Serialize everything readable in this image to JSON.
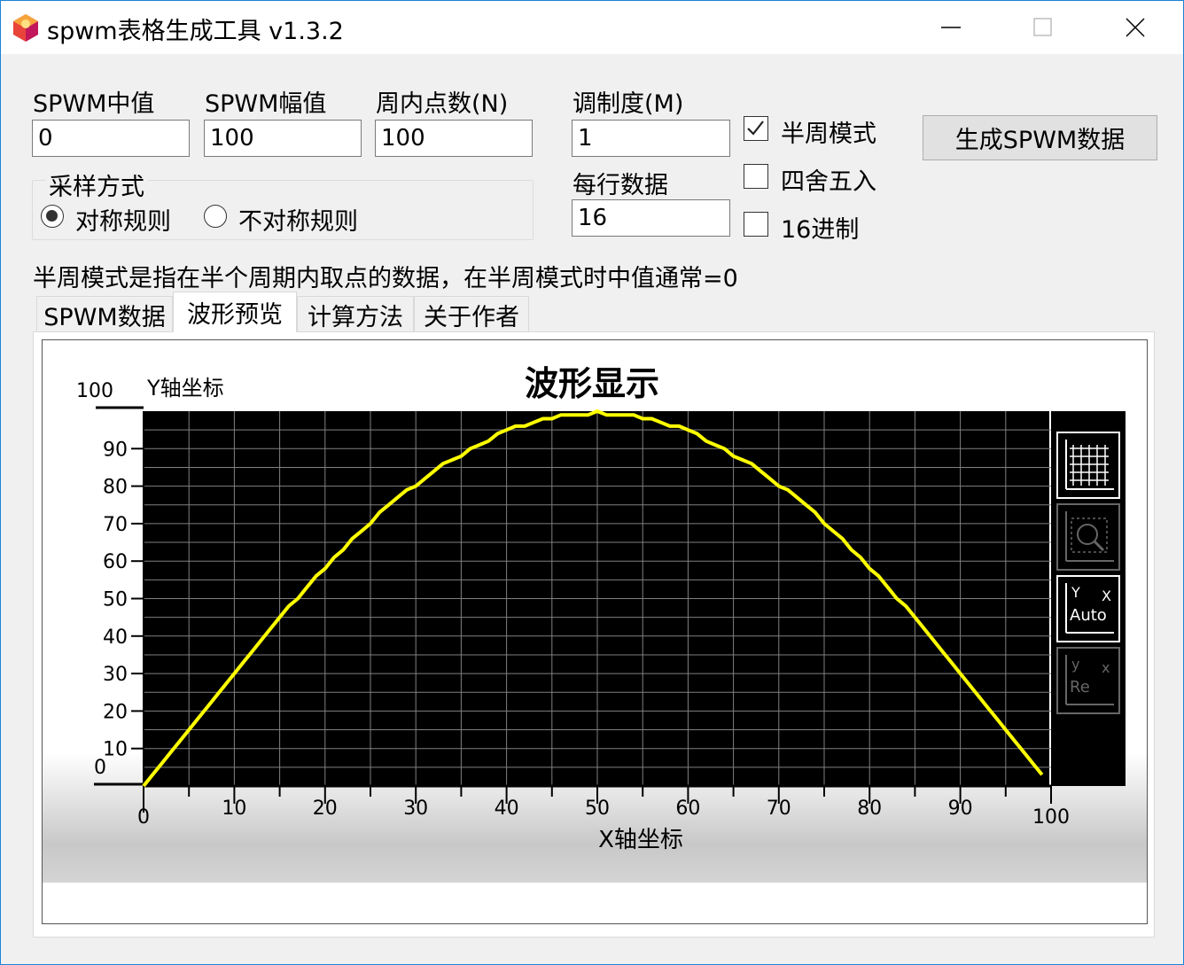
{
  "window": {
    "title": "spwm表格生成工具 v1.3.2"
  },
  "fields": {
    "center": {
      "label": "SPWM中值",
      "value": "0"
    },
    "amplitude": {
      "label": "SPWM幅值",
      "value": "100"
    },
    "points": {
      "label": "周内点数(N)",
      "value": "100"
    },
    "modulation": {
      "label": "调制度(M)",
      "value": "1"
    },
    "per_row": {
      "label": "每行数据",
      "value": "16"
    }
  },
  "sampling": {
    "title": "采样方式",
    "options": [
      {
        "label": "对称规则",
        "selected": true
      },
      {
        "label": "不对称规则",
        "selected": false
      }
    ]
  },
  "checkboxes": [
    {
      "label": "半周模式",
      "checked": true
    },
    {
      "label": "四舍五入",
      "checked": false
    },
    {
      "label": "16进制",
      "checked": false
    }
  ],
  "generate_button": "生成SPWM数据",
  "hint": "半周模式是指在半个周期内取点的数据，在半周模式时中值通常=0",
  "tabs": [
    {
      "label": "SPWM数据",
      "active": false
    },
    {
      "label": "波形预览",
      "active": true
    },
    {
      "label": "计算方法",
      "active": false
    },
    {
      "label": "关于作者",
      "active": false
    }
  ],
  "colors": {
    "line": "#ffff00",
    "plot_bg": "#000000",
    "grid": "#808080"
  },
  "chart_data": {
    "type": "line",
    "title": "波形显示",
    "xlabel": "X轴坐标",
    "ylabel": "Y轴坐标",
    "xlim": [
      0,
      100
    ],
    "ylim": [
      0,
      100
    ],
    "x_ticks": [
      "0",
      "10",
      "20",
      "30",
      "40",
      "50",
      "60",
      "70",
      "80",
      "90",
      "100"
    ],
    "y_ticks": [
      "0",
      "10",
      "20",
      "30",
      "40",
      "50",
      "60",
      "70",
      "80",
      "90",
      "100"
    ],
    "grid": true,
    "series": [
      {
        "x": [
          0,
          1,
          2,
          3,
          4,
          5,
          6,
          7,
          8,
          9,
          10,
          11,
          12,
          13,
          14,
          15,
          16,
          17,
          18,
          19,
          20,
          21,
          22,
          23,
          24,
          25,
          26,
          27,
          28,
          29,
          30,
          31,
          32,
          33,
          34,
          35,
          36,
          37,
          38,
          39,
          40,
          41,
          42,
          43,
          44,
          45,
          46,
          47,
          48,
          49,
          50,
          51,
          52,
          53,
          54,
          55,
          56,
          57,
          58,
          59,
          60,
          61,
          62,
          63,
          64,
          65,
          66,
          67,
          68,
          69,
          70,
          71,
          72,
          73,
          74,
          75,
          76,
          77,
          78,
          79,
          80,
          81,
          82,
          83,
          84,
          85,
          86,
          87,
          88,
          89,
          90,
          91,
          92,
          93,
          94,
          95,
          96,
          97,
          98,
          99
        ],
        "values": [
          0,
          3,
          6,
          9,
          12,
          15,
          18,
          21,
          24,
          27,
          30,
          33,
          36,
          39,
          42,
          45,
          48,
          50,
          53,
          56,
          58,
          61,
          63,
          66,
          68,
          70,
          73,
          75,
          77,
          79,
          80,
          82,
          84,
          86,
          87,
          88,
          90,
          91,
          92,
          94,
          95,
          96,
          96,
          97,
          98,
          98,
          99,
          99,
          99,
          99,
          100,
          99,
          99,
          99,
          99,
          98,
          98,
          97,
          96,
          96,
          95,
          94,
          92,
          91,
          90,
          88,
          87,
          86,
          84,
          82,
          80,
          79,
          77,
          75,
          73,
          70,
          68,
          66,
          63,
          61,
          58,
          56,
          53,
          50,
          48,
          45,
          42,
          39,
          36,
          33,
          30,
          27,
          24,
          21,
          18,
          15,
          12,
          9,
          6,
          3
        ]
      }
    ]
  },
  "chart_tools": [
    {
      "name": "grid-toggle-icon"
    },
    {
      "name": "zoom-icon"
    },
    {
      "name": "auto-scale-icon",
      "label_y": "Y",
      "label_x": "X",
      "label": "Auto"
    },
    {
      "name": "reset-icon",
      "label_y": "y",
      "label_x": "x",
      "label": "Re"
    }
  ]
}
